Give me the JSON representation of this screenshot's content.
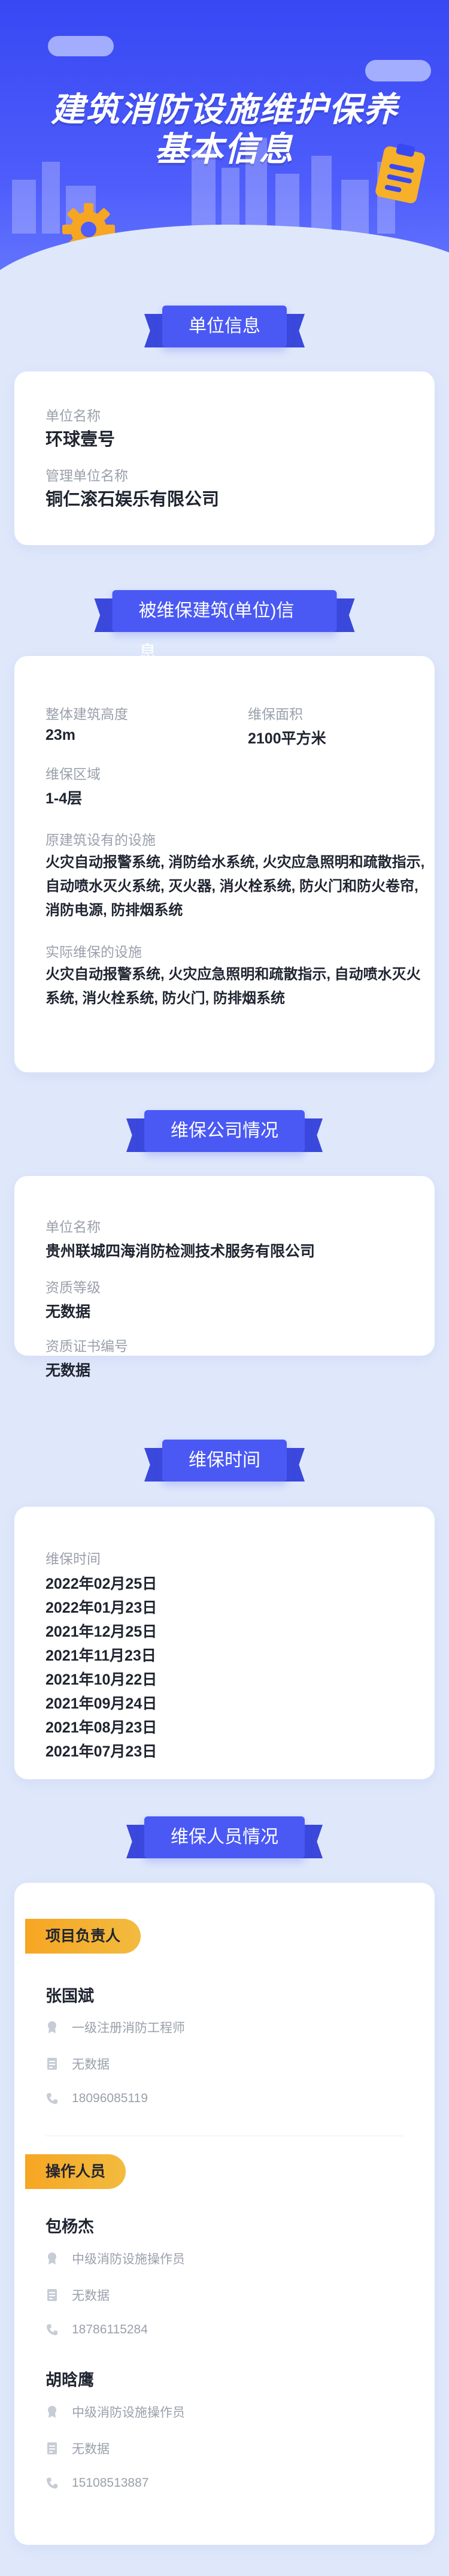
{
  "hero": {
    "title_line1": "建筑消防设施维护保养",
    "title_line2": "基本信息"
  },
  "colors": {
    "primary": "#4a59f4",
    "accent": "#f6a623",
    "page_bg": "#dfe8fb"
  },
  "unit_info": {
    "section_title": "单位信息",
    "unit_name_label": "单位名称",
    "unit_name": "环球壹号",
    "manager_label": "管理单位名称",
    "manager": "铜仁滚石娱乐有限公司"
  },
  "building": {
    "section_title": "被维保建筑(单位)信息",
    "height_label": "整体建筑高度",
    "height": "23m",
    "area_label": "维保面积",
    "area": "2100平方米",
    "zone_label": "维保区域",
    "zone": "1-4层",
    "original_label": "原建筑设有的设施",
    "original": "火灾自动报警系统, 消防给水系统, 火灾应急照明和疏散指示, 自动喷水灭火系统, 灭火器, 消火栓系统, 防火门和防火卷帘, 消防电源, 防排烟系统",
    "actual_label": "实际维保的设施",
    "actual": "火灾自动报警系统, 火灾应急照明和疏散指示, 自动喷水灭火系统, 消火栓系统, 防火门, 防排烟系统"
  },
  "company": {
    "section_title": "维保公司情况",
    "name_label": "单位名称",
    "name": "贵州联城四海消防检测技术服务有限公司",
    "level_label": "资质等级",
    "level": "无数据",
    "cert_label": "资质证书编号",
    "cert": "无数据"
  },
  "schedule": {
    "section_title": "维保时间",
    "label": "维保时间",
    "dates": [
      "2022年02月25日",
      "2022年01月23日",
      "2021年12月25日",
      "2021年11月23日",
      "2021年10月22日",
      "2021年09月24日",
      "2021年08月23日",
      "2021年07月23日"
    ]
  },
  "staff": {
    "section_title": "维保人员情况",
    "leader_tag": "项目负责人",
    "operator_tag": "操作人员",
    "leader": {
      "name": "张国斌",
      "title": "一级注册消防工程师",
      "cert": "无数据",
      "phone": "18096085119"
    },
    "operators": [
      {
        "name": "包杨杰",
        "title": "中级消防设施操作员",
        "cert": "无数据",
        "phone": "18786115284"
      },
      {
        "name": "胡晗鹰",
        "title": "中级消防设施操作员",
        "cert": "无数据",
        "phone": "15108513887"
      }
    ]
  }
}
